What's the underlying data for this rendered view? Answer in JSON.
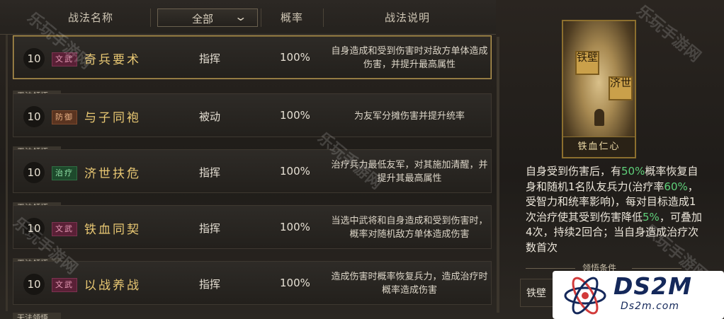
{
  "header": {
    "col_name": "战法名称",
    "filter_value": "全部",
    "col_rate": "概率",
    "col_desc": "战法说明"
  },
  "rows": [
    {
      "level": "10",
      "tag": "文武",
      "name": "奇兵要术",
      "type": "指挥",
      "rate": "100%",
      "desc": "自身造成和受到伤害时对敌方单体造成伤害，并提升最高属性",
      "unable": ""
    },
    {
      "level": "10",
      "tag": "防御",
      "name": "与子同袍",
      "type": "被动",
      "rate": "100%",
      "desc": "为友军分摊伤害并提升统率",
      "unable": "无法领悟"
    },
    {
      "level": "10",
      "tag": "治疗",
      "name": "济世扶危",
      "type": "指挥",
      "rate": "100%",
      "desc": "治疗兵力最低友军，对其施加清醒，并提升其最高属性",
      "unable": "无法领悟"
    },
    {
      "level": "10",
      "tag": "文武",
      "name": "铁血同契",
      "type": "指挥",
      "rate": "100%",
      "desc": "当选中武将和自身造成和受到伤害时，概率对随机敌方单体造成伤害",
      "unable": "无法领悟"
    },
    {
      "level": "10",
      "tag": "文武",
      "name": "以战养战",
      "type": "指挥",
      "rate": "100%",
      "desc": "造成伤害时概率恢复兵力，造成治疗时概率造成伤害",
      "unable": "无法领悟"
    }
  ],
  "next_row_unable": "无法领悟",
  "card": {
    "seal1": "铁壁",
    "seal2": "济世",
    "name": "铁血仁心"
  },
  "detail": {
    "p1": "自身受到伤害后，有",
    "v1": "50%",
    "p2": "概率恢复自身和随机1名队友兵力(治疗率",
    "v2": "60%",
    "p3": "，受智力和统率影响)，每对目标造成1次治疗使其受到伤害降低",
    "v3": "5%",
    "p4": "，可叠加4次，持续2回合；当自身造成治疗次数首次"
  },
  "condition": {
    "label": "领悟条件",
    "value": "铁壁"
  },
  "watermark": {
    "text": "乐玩手游网"
  },
  "logo": {
    "main": "DS2M",
    "sub": "Ds2m.com"
  },
  "colors": {
    "gold": "#e9c873",
    "highlight_green": "#5fd07a",
    "selected_border": "#b89a55"
  }
}
